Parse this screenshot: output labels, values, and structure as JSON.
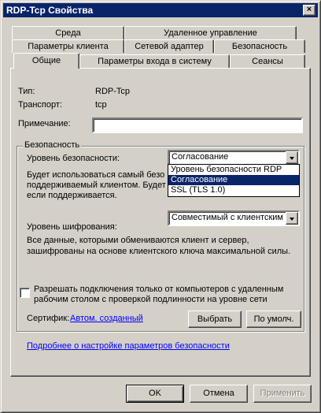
{
  "window": {
    "title": "RDP-Tcp Свойства",
    "close_glyph": "×"
  },
  "tabs": {
    "row1": [
      "Среда",
      "Удаленное управление"
    ],
    "row2": [
      "Параметры клиента",
      "Сетевой адаптер",
      "Безопасность"
    ],
    "row3": [
      "Общие",
      "Параметры входа в систему",
      "Сеансы"
    ],
    "active": "Общие"
  },
  "general": {
    "type_label": "Тип:",
    "type_value": "RDP-Tcp",
    "transport_label": "Транспорт:",
    "transport_value": "tcp",
    "note_label": "Примечание:",
    "note_value": ""
  },
  "security": {
    "group_title": "Безопасность",
    "level_label": "Уровень безопасности:",
    "level_value": "Согласование",
    "level_desc": [
      "Будет использоваться самый безо",
      "поддерживаемый клиентом. Будет",
      "если поддерживается."
    ],
    "level_options": [
      "Уровень безопасности RDP",
      "Согласование",
      "SSL (TLS 1.0)"
    ],
    "selected_option": "Согласование",
    "encryption_label": "Уровень шифрования:",
    "encryption_value": "Совместимый с клиентским",
    "encryption_desc": [
      "Все данные, которыми обмениваются клиент и сервер,",
      "зашифрованы на основе клиентского ключа максимальной силы."
    ],
    "nla_checkbox_lines": [
      "Разрешать подключения только от компьютеров с удаленным",
      "рабочим столом с проверкой подлинности на уровне сети"
    ],
    "nla_checked": false,
    "certificate_label": "Сертифик:",
    "certificate_link": "Автом. созданный",
    "select_button": "Выбрать",
    "default_button": "По умолч.",
    "more_link": "Подробнее о настройке параметров безопасности"
  },
  "footer": {
    "ok": "OK",
    "cancel": "Отмена",
    "apply": "Применить"
  }
}
